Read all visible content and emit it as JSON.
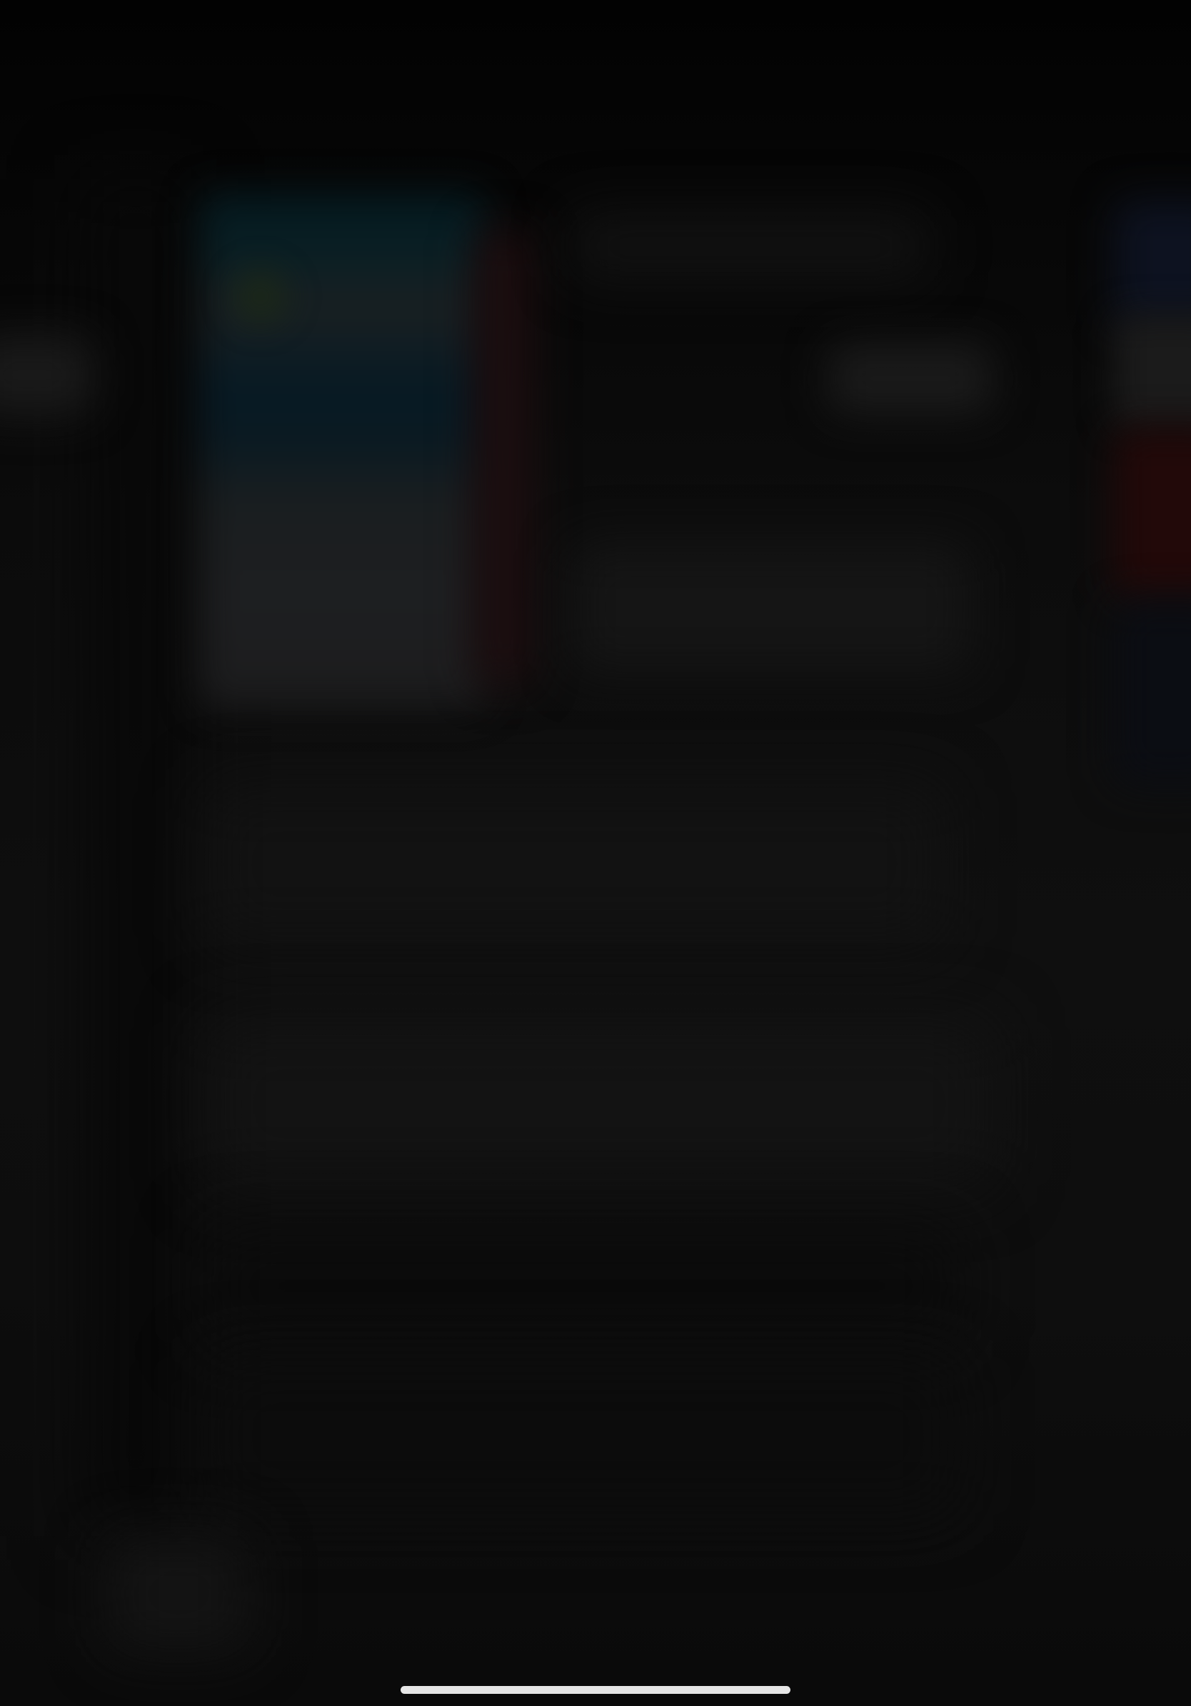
{
  "screen": {
    "state": "blurred-background-overlay"
  },
  "colors": {
    "background_top": "#020202",
    "background_mid": "#0f0f0f",
    "background_bottom": "#0a0a0a",
    "artwork_teal": "#0a1f24",
    "accent_red": "#220909",
    "home_indicator": "#e6e6e6"
  },
  "home_indicator": {
    "icon": "home-indicator-bar"
  }
}
